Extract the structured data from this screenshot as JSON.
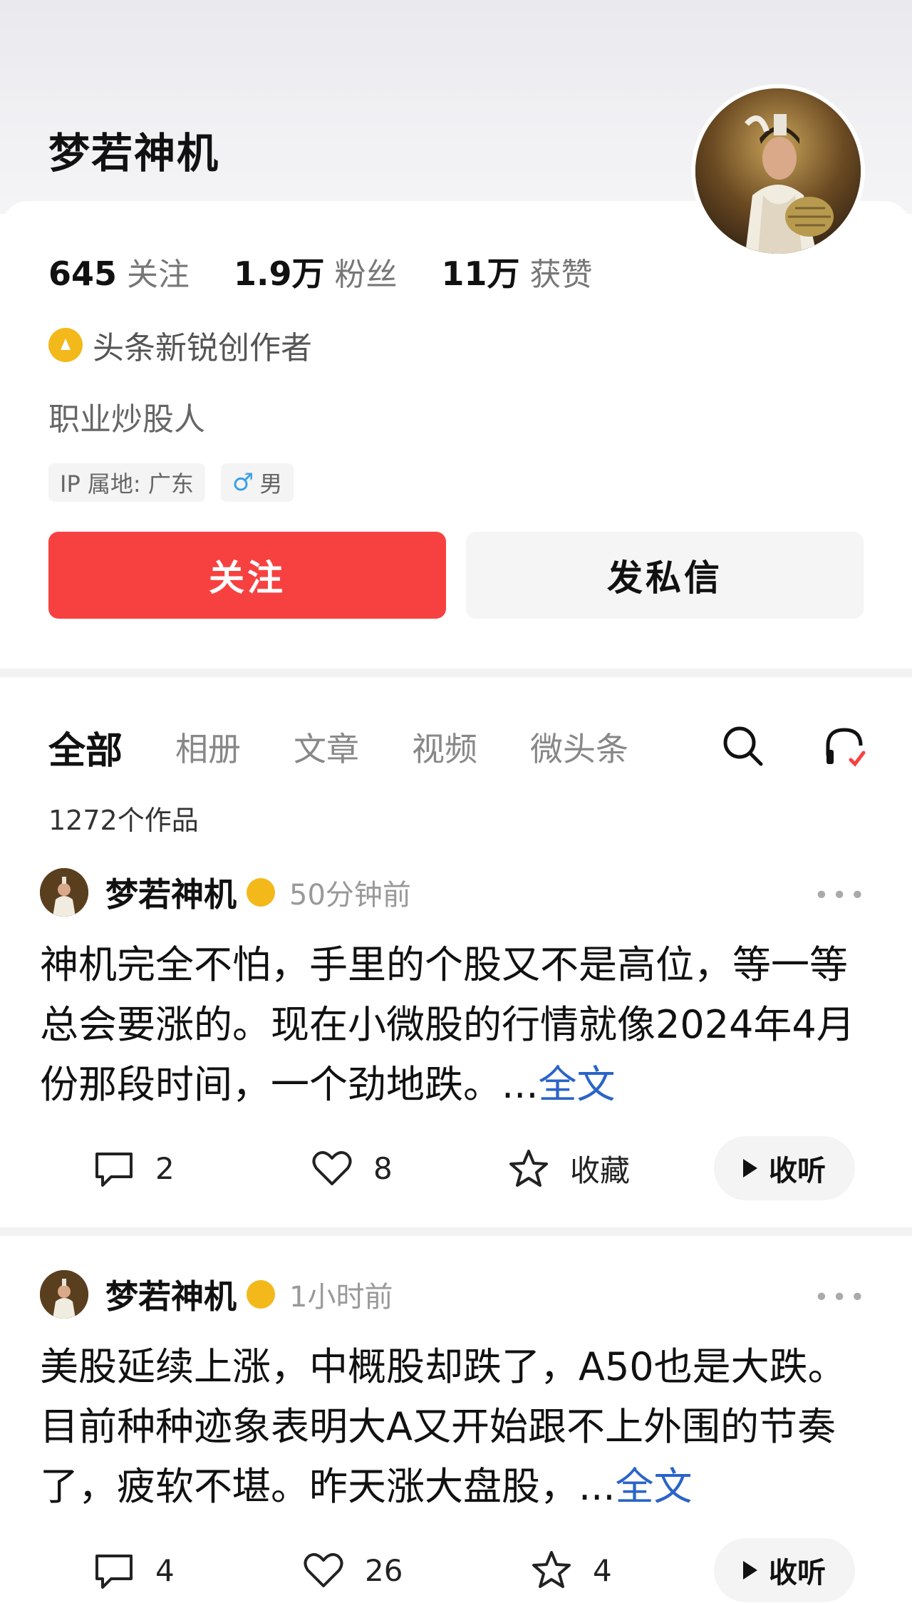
{
  "profile": {
    "name": "梦若神机",
    "stats": [
      {
        "num": "645",
        "label": "关注"
      },
      {
        "num": "1.9万",
        "label": "粉丝"
      },
      {
        "num": "11万",
        "label": "获赞"
      }
    ],
    "creator_badge": "头条新锐创作者",
    "bio": "职业炒股人",
    "ip_tag": "IP 属地: 广东",
    "gender_symbol": "♂",
    "gender_tag": "男",
    "follow_label": "关注",
    "message_label": "发私信"
  },
  "tabs": [
    "全部",
    "相册",
    "文章",
    "视频",
    "微头条"
  ],
  "works_count": "1272个作品",
  "posts": [
    {
      "author": "梦若神机",
      "time": "50分钟前",
      "text": "神机完全不怕，手里的个股又不是高位，等一等总会要涨的。现在小微股的行情就像2024年4月份那段时间，一个劲地跌。...",
      "full_label": "全文",
      "comments": "2",
      "likes": "8",
      "favorite": "收藏",
      "listen": "收听"
    },
    {
      "author": "梦若神机",
      "time": "1小时前",
      "text": "美股延续上涨，中概股却跌了，A50也是大跌。目前种种迹象表明大A又开始跟不上外围的节奏了，疲软不堪。昨天涨大盘股，...",
      "full_label": "全文",
      "comments": "4",
      "likes": "26",
      "favorite": "4",
      "listen": "收听"
    }
  ],
  "colors": {
    "accent": "#f74141",
    "link": "#2a64c8",
    "badge": "#f3b81a"
  }
}
